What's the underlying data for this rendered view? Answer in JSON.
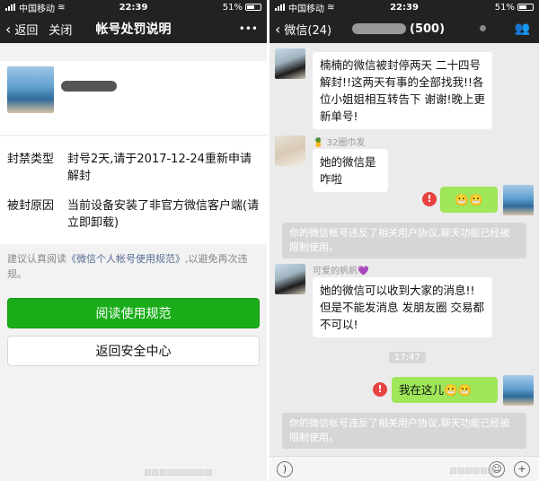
{
  "status": {
    "carrier": "中国移动",
    "time": "22:39",
    "battery": "51%"
  },
  "left": {
    "nav": {
      "back": "返回",
      "close": "关闭",
      "title": "帐号处罚说明",
      "more": "•••"
    },
    "info": {
      "ban_type_label": "封禁类型",
      "ban_type_value": "封号2天,请于2017-12-24重新申请解封",
      "reason_label": "被封原因",
      "reason_value": "当前设备安装了非官方微信客户端(请立即卸载)"
    },
    "note_prefix": "建议认真阅读",
    "note_link": "《微信个人帐号使用规范》",
    "note_suffix": ",以避免再次违规。",
    "primary_button": "阅读使用规范",
    "secondary_button": "返回安全中心"
  },
  "right": {
    "nav": {
      "back": "微信(24)",
      "title": "(500)"
    },
    "messages": {
      "m1_sender": "可爱的帆帆💜",
      "m1_text": "楠楠的微信被封停两天 二十四号解封!!这两天有事的全部找我!!各位小姐姐相互转告下 谢谢!晚上更新单号!",
      "m2_sender": "🍍 32圈巾发",
      "m2_text": "她的微信是咋啦",
      "m3_text": "😬😬",
      "sys1": "你的微信帐号违反了相关用户协议,聊天功能已经被限制使用。",
      "m4_sender": "可爱的帆帆💜",
      "m4_text": "她的微信可以收到大家的消息!!但是不能发消息 发朋友圈 交易都不可以!",
      "time_chip": "17:47",
      "m5_text": "我在这儿😬😬",
      "sys2": "你的微信帐号违反了相关用户协议,聊天功能已经被限制使用。"
    }
  },
  "colors": {
    "wechat_green": "#1aad19",
    "bubble_green": "#9fe658",
    "error_red": "#e64340",
    "nav_dark": "#222222"
  }
}
